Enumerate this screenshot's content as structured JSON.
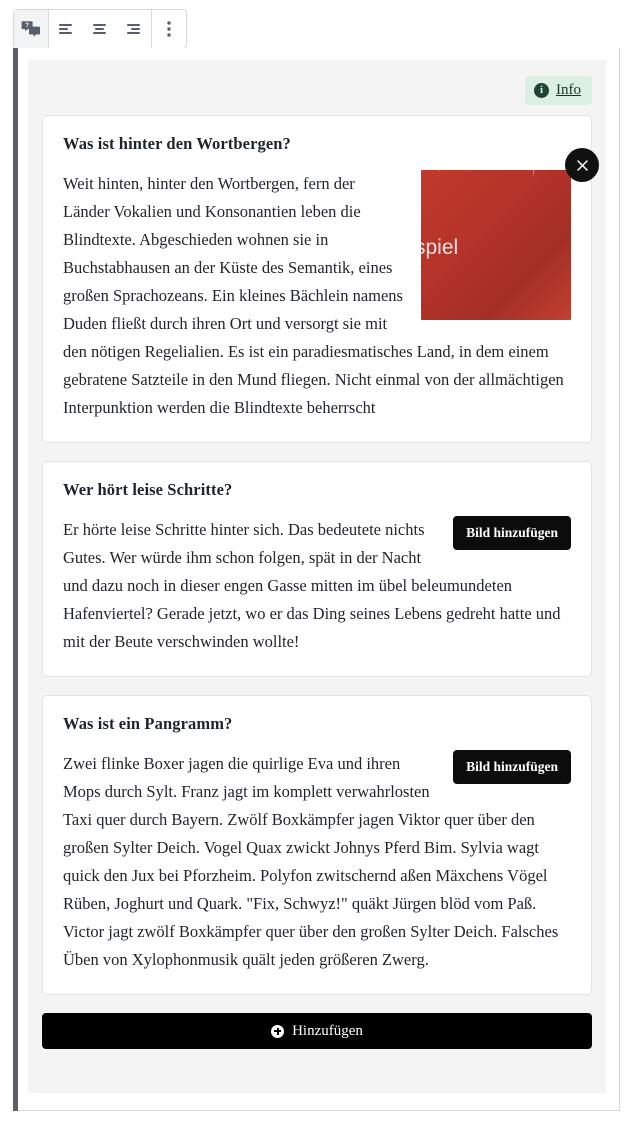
{
  "toolbar": {
    "groups": [
      {
        "buttons": [
          {
            "icon": "faq-chat-icon",
            "label": "FAQ",
            "active": true
          }
        ]
      },
      {
        "buttons": [
          {
            "icon": "align-left-icon",
            "label": "Linksbündig",
            "active": false
          },
          {
            "icon": "align-center-icon",
            "label": "Zentriert",
            "active": false
          },
          {
            "icon": "align-right-icon",
            "label": "Rechtsbündig",
            "active": false
          }
        ]
      },
      {
        "buttons": [
          {
            "icon": "more-vertical-icon",
            "label": "Mehr",
            "active": false
          }
        ]
      }
    ]
  },
  "info": {
    "icon": "info-circle-icon",
    "icon_glyph": "i",
    "label": "Info",
    "background": "#dcefe3",
    "accent": "#1f4433"
  },
  "cards": [
    {
      "title": "Was ist hinter den Wortbergen?",
      "body": "Weit hinten, hinter den Wortbergen, fern der Länder Vokalien und Konsonantien leben die Blindtexte. Abgeschieden wohnen sie in Buchstabhausen an der Küste des Semantik, eines großen Sprachozeans. Ein kleines Bächlein namens Duden fließt durch ihren Ort und versorgt sie mit den nötigen Regelialien. Es ist ein paradiesmatisches Land, in dem einem gebratene Satzteile in den Mund fliegen. Nicht einmal von der allmächtigen Interpunktion werden die Blindtexte beherrscht",
      "has_image": true,
      "image_caption": "spiel",
      "image_color": "#b5332a",
      "close_label": "×"
    },
    {
      "title": "Wer hört leise Schritte?",
      "body": "Er hörte leise Schritte hinter sich. Das bedeutete nichts Gutes. Wer würde ihm schon folgen, spät in der Nacht und dazu noch in dieser engen Gasse mitten im übel beleumundeten Hafenviertel? Gerade jetzt, wo er das Ding seines Lebens gedreht hatte und mit der Beute verschwinden wollte!",
      "has_image": false,
      "add_image_label": "Bild hinzufügen"
    },
    {
      "title": "Was ist ein Pangramm?",
      "body": "Zwei flinke Boxer jagen die quirlige Eva und ihren Mops durch Sylt. Franz jagt im komplett verwahrlosten Taxi quer durch Bayern. Zwölf Boxkämpfer jagen Viktor quer über den großen Sylter Deich. Vogel Quax zwickt Johnys Pferd Bim. Sylvia wagt quick den Jux bei Pforzheim. Polyfon zwitschernd aßen Mäxchens Vögel Rüben, Joghurt und Quark. \"Fix, Schwyz!\" quäkt Jürgen blöd vom Paß. Victor jagt zwölf Boxkämpfer quer über den großen Sylter Deich. Falsches Üben von Xylophonmusik quält jeden größeren Zwerg.",
      "has_image": false,
      "add_image_label": "Bild hinzufügen"
    }
  ],
  "footer": {
    "add_label": "Hinzufügen",
    "add_icon": "plus-circle-icon"
  }
}
